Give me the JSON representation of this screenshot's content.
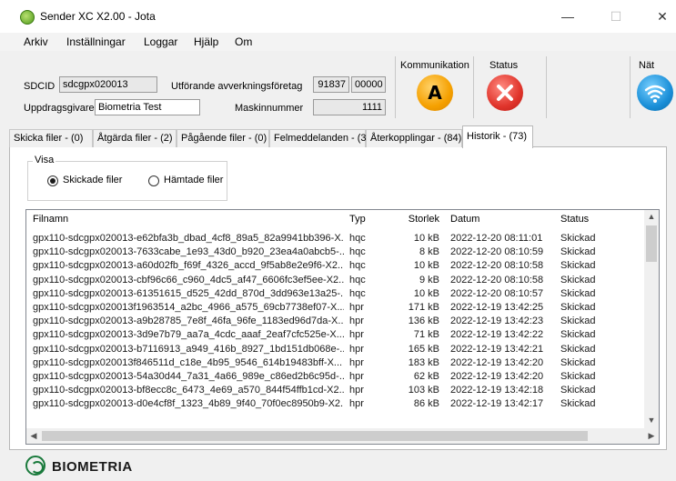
{
  "window": {
    "title": "Sender XC X2.00 - Jota"
  },
  "menu": [
    "Arkiv",
    "Inställningar",
    "Loggar",
    "Hjälp",
    "Om"
  ],
  "info": {
    "sdcid_label": "SDCID",
    "sdcid_value": "sdcgpx020013",
    "uppdragsgivare_label": "Uppdragsgivare",
    "uppdragsgivare_value": "Biometria Test",
    "utforande_label": "Utförande avverkningsföretag",
    "utforande_value1": "91837",
    "utforande_value2": "00000",
    "maskinnummer_label": "Maskinnummer",
    "maskinnummer_value": "1111"
  },
  "indicators": {
    "kommunikation_label": "Kommunikation",
    "kommunikation_letter": "A",
    "status_label": "Status",
    "nat_label": "Nät"
  },
  "tabs": [
    "Skicka filer - (0)",
    "Åtgärda filer - (2)",
    "Pågående filer - (0)",
    "Felmeddelanden - (3)",
    "Återkopplingar - (84)",
    "Historik - (73)"
  ],
  "visa": {
    "legend": "Visa",
    "option1": "Skickade filer",
    "option2": "Hämtade filer",
    "selected": "Skickade filer"
  },
  "table": {
    "headers": {
      "filnamn": "Filnamn",
      "typ": "Typ",
      "storlek": "Storlek",
      "datum": "Datum",
      "status": "Status"
    },
    "rows": [
      [
        "gpx110-sdcgpx020013-e62bfa3b_dbad_4cf8_89a5_82a9941bb396-X...",
        "hqc",
        "10 kB",
        "2022-12-20 08:11:01",
        "Skickad"
      ],
      [
        "gpx110-sdcgpx020013-7633cabe_1e93_43d0_b920_23ea4a0abcb5-...",
        "hqc",
        "8 kB",
        "2022-12-20 08:10:59",
        "Skickad"
      ],
      [
        "gpx110-sdcgpx020013-a60d02fb_f69f_4326_accd_9f5ab8e2e9f6-X2....",
        "hqc",
        "10 kB",
        "2022-12-20 08:10:58",
        "Skickad"
      ],
      [
        "gpx110-sdcgpx020013-cbf96c66_c960_4dc5_af47_6606fc3ef5ee-X2...",
        "hqc",
        "9 kB",
        "2022-12-20 08:10:58",
        "Skickad"
      ],
      [
        "gpx110-sdcgpx020013-61351615_d525_42dd_870d_3dd963e13a25-...",
        "hqc",
        "10 kB",
        "2022-12-20 08:10:57",
        "Skickad"
      ],
      [
        "gpx110-sdcgpx020013f1963514_a2bc_4966_a575_69cb7738ef07-X...",
        "hpr",
        "171 kB",
        "2022-12-19 13:42:25",
        "Skickad"
      ],
      [
        "gpx110-sdcgpx020013-a9b28785_7e8f_46fa_96fe_1183ed96d7da-X...",
        "hpr",
        "136 kB",
        "2022-12-19 13:42:23",
        "Skickad"
      ],
      [
        "gpx110-sdcgpx020013-3d9e7b79_aa7a_4cdc_aaaf_2eaf7cfc525e-X...",
        "hpr",
        "71 kB",
        "2022-12-19 13:42:22",
        "Skickad"
      ],
      [
        "gpx110-sdcgpx020013-b7116913_a949_416b_8927_1bd151db068e-...",
        "hpr",
        "165 kB",
        "2022-12-19 13:42:21",
        "Skickad"
      ],
      [
        "gpx110-sdcgpx020013f846511d_c18e_4b95_9546_614b19483bff-X...",
        "hpr",
        "183 kB",
        "2022-12-19 13:42:20",
        "Skickad"
      ],
      [
        "gpx110-sdcgpx020013-54a30d44_7a31_4a66_989e_c86ed2b6c95d-...",
        "hpr",
        "62 kB",
        "2022-12-19 13:42:20",
        "Skickad"
      ],
      [
        "gpx110-sdcgpx020013-bf8ecc8c_6473_4e69_a570_844f54ffb1cd-X2...",
        "hpr",
        "103 kB",
        "2022-12-19 13:42:18",
        "Skickad"
      ],
      [
        "gpx110-sdcgpx020013-d0e4cf8f_1323_4b89_9f40_70f0ec8950b9-X2...",
        "hpr",
        "86 kB",
        "2022-12-19 13:42:17",
        "Skickad"
      ]
    ]
  },
  "footer": {
    "brand": "BIOMETRIA"
  },
  "colors": {
    "accent": "#f5a000",
    "error": "#e0342b",
    "network": "#1a8fd8",
    "brand": "#1a7a3c"
  },
  "icons": [
    "app-icon",
    "minimize-icon",
    "maximize-icon",
    "close-icon",
    "communication-a-icon",
    "status-error-icon",
    "network-wifi-icon",
    "biometria-logo-icon"
  ]
}
